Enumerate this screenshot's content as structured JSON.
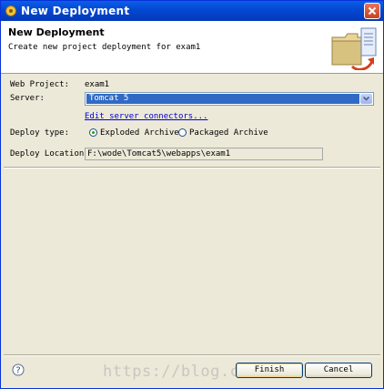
{
  "window": {
    "title": "New Deployment"
  },
  "header": {
    "title": "New Deployment",
    "description": "Create new project deployment for exam1"
  },
  "form": {
    "web_project_label": "Web Project:",
    "web_project_value": "exam1",
    "server_label": "Server:",
    "server_value": "Tomcat 5",
    "edit_link": "Edit server connectors...",
    "deploy_type_label": "Deploy type:",
    "deploy_type_options": [
      "Exploded Archive",
      "Packaged Archive"
    ],
    "deploy_type_selected": "Exploded Archive",
    "deploy_location_label": "Deploy Location:",
    "deploy_location_value": "F:\\wode\\Tomcat5\\webapps\\exam1"
  },
  "footer": {
    "finish_label": "Finish",
    "cancel_label": "Cancel",
    "watermark": "https://blog.c"
  },
  "icons": {
    "title": "app-icon",
    "close": "close-icon",
    "banner": "deploy-banner-icon",
    "help": "help-icon",
    "dropdown": "chevron-down-icon"
  },
  "colors": {
    "titlebar": "#0447d0",
    "selection": "#316ac5",
    "link": "#0000cc"
  }
}
